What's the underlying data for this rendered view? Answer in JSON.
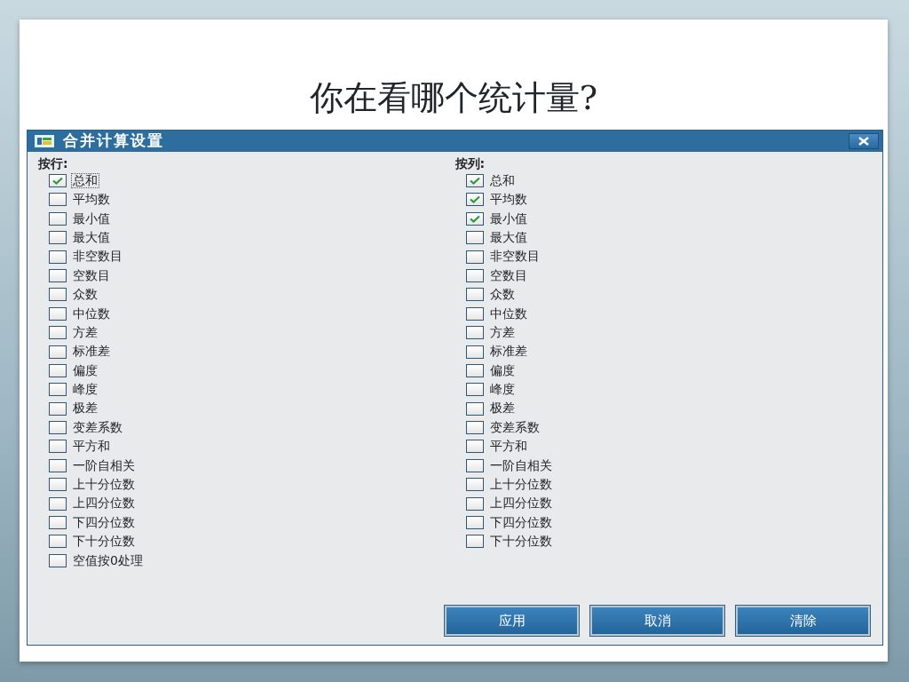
{
  "slide_title": "你在看哪个统计量?",
  "dialog": {
    "title": "合并计算设置",
    "groups": [
      {
        "heading": "按行:",
        "items": [
          {
            "label": "总和",
            "checked": true,
            "focused": true
          },
          {
            "label": "平均数",
            "checked": false
          },
          {
            "label": "最小值",
            "checked": false
          },
          {
            "label": "最大值",
            "checked": false
          },
          {
            "label": "非空数目",
            "checked": false
          },
          {
            "label": "空数目",
            "checked": false
          },
          {
            "label": "众数",
            "checked": false
          },
          {
            "label": "中位数",
            "checked": false
          },
          {
            "label": "方差",
            "checked": false
          },
          {
            "label": "标准差",
            "checked": false
          },
          {
            "label": "偏度",
            "checked": false
          },
          {
            "label": "峰度",
            "checked": false
          },
          {
            "label": "极差",
            "checked": false
          },
          {
            "label": "变差系数",
            "checked": false
          },
          {
            "label": "平方和",
            "checked": false
          },
          {
            "label": "一阶自相关",
            "checked": false
          },
          {
            "label": "上十分位数",
            "checked": false
          },
          {
            "label": "上四分位数",
            "checked": false
          },
          {
            "label": "下四分位数",
            "checked": false
          },
          {
            "label": "下十分位数",
            "checked": false
          },
          {
            "label": "空值按0处理",
            "checked": false
          }
        ]
      },
      {
        "heading": "按列:",
        "items": [
          {
            "label": "总和",
            "checked": true
          },
          {
            "label": "平均数",
            "checked": true
          },
          {
            "label": "最小值",
            "checked": true
          },
          {
            "label": "最大值",
            "checked": false
          },
          {
            "label": "非空数目",
            "checked": false
          },
          {
            "label": "空数目",
            "checked": false
          },
          {
            "label": "众数",
            "checked": false
          },
          {
            "label": "中位数",
            "checked": false
          },
          {
            "label": "方差",
            "checked": false
          },
          {
            "label": "标准差",
            "checked": false
          },
          {
            "label": "偏度",
            "checked": false
          },
          {
            "label": "峰度",
            "checked": false
          },
          {
            "label": "极差",
            "checked": false
          },
          {
            "label": "变差系数",
            "checked": false
          },
          {
            "label": "平方和",
            "checked": false
          },
          {
            "label": "一阶自相关",
            "checked": false
          },
          {
            "label": "上十分位数",
            "checked": false
          },
          {
            "label": "上四分位数",
            "checked": false
          },
          {
            "label": "下四分位数",
            "checked": false
          },
          {
            "label": "下十分位数",
            "checked": false
          }
        ]
      }
    ],
    "buttons": [
      "应用",
      "取消",
      "清除"
    ]
  }
}
